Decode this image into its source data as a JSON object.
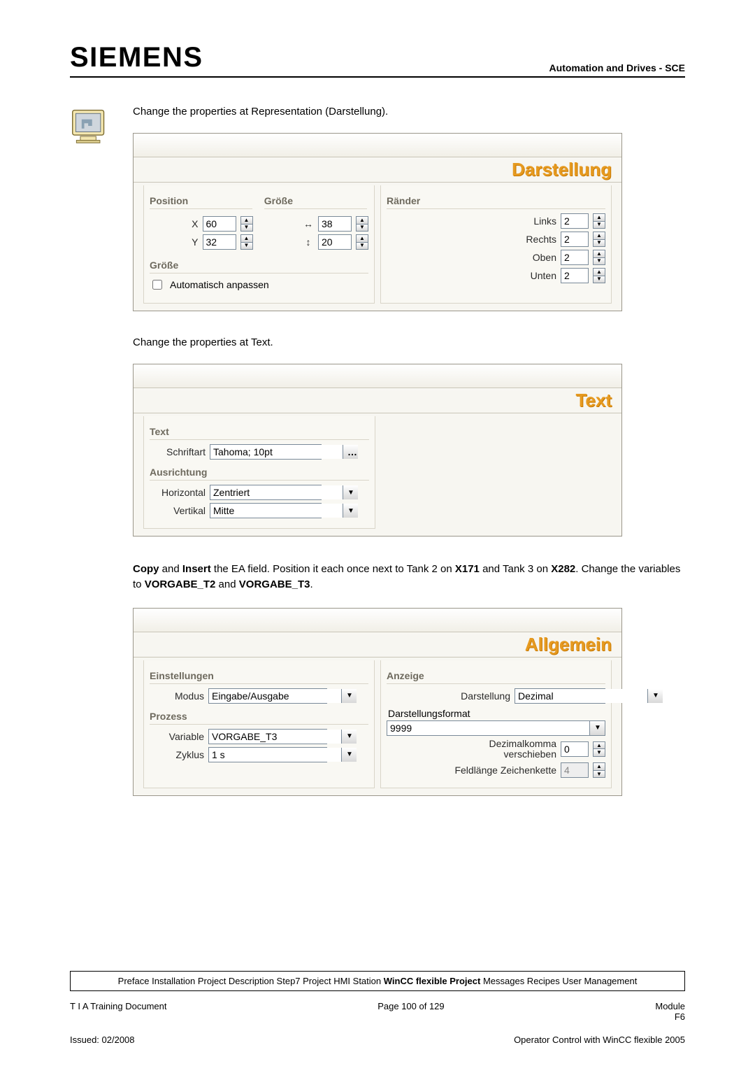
{
  "header": {
    "brand": "SIEMENS",
    "right": "Automation and Drives - SCE"
  },
  "intro1": "Change the properties at Representation (Darstellung).",
  "panel1": {
    "title": "Darstellung",
    "position_label": "Position",
    "size_label": "Größe",
    "margins_label": "Ränder",
    "x_label": "X",
    "x_value": "60",
    "y_label": "Y",
    "y_value": "32",
    "w_value": "38",
    "h_value": "20",
    "size2_label": "Größe",
    "auto_label": "Automatisch anpassen",
    "m_left_label": "Links",
    "m_left_value": "2",
    "m_right_label": "Rechts",
    "m_right_value": "2",
    "m_top_label": "Oben",
    "m_top_value": "2",
    "m_bottom_label": "Unten",
    "m_bottom_value": "2"
  },
  "intro2": "Change the properties at Text.",
  "panel2": {
    "title": "Text",
    "text_label": "Text",
    "font_label": "Schriftart",
    "font_value": "Tahoma; 10pt",
    "align_label": "Ausrichtung",
    "h_label": "Horizontal",
    "h_value": "Zentriert",
    "v_label": "Vertikal",
    "v_value": "Mitte"
  },
  "intro3_parts": {
    "a": "Copy",
    "b": " and ",
    "c": "Insert",
    "d": " the EA field. Position it each once next to Tank 2 on ",
    "e": "X171",
    "f": " and Tank 3 on ",
    "g": "X282",
    "h": ". Change the variables to ",
    "i": "VORGABE_T2",
    "j": " and ",
    "k": "VORGABE_T3",
    "l": "."
  },
  "panel3": {
    "title": "Allgemein",
    "settings_label": "Einstellungen",
    "mode_label": "Modus",
    "mode_value": "Eingabe/Ausgabe",
    "process_label": "Prozess",
    "var_label": "Variable",
    "var_value": "VORGABE_T3",
    "cycle_label": "Zyklus",
    "cycle_value": "1 s",
    "display_label": "Anzeige",
    "repr_label": "Darstellung",
    "repr_value": "Dezimal",
    "format_label": "Darstellungsformat",
    "format_value": "9999",
    "dec_label_a": "Dezimalkomma",
    "dec_label_b": "verschieben",
    "dec_value": "0",
    "len_label": "Feldlänge Zeichenkette",
    "len_value": "4"
  },
  "footer_bar": {
    "parts": {
      "a": "Preface Installation Project Description Step7 Project HMI Station ",
      "b": "WinCC flexible Project",
      "c": " Messages Recipes User Management"
    }
  },
  "footer": {
    "left1": "T I A  Training Document",
    "mid1": "Page 100 of 129",
    "right1a": "Module",
    "right1b": "F6",
    "left2": "Issued: 02/2008",
    "right2": "Operator Control with WinCC flexible 2005"
  }
}
